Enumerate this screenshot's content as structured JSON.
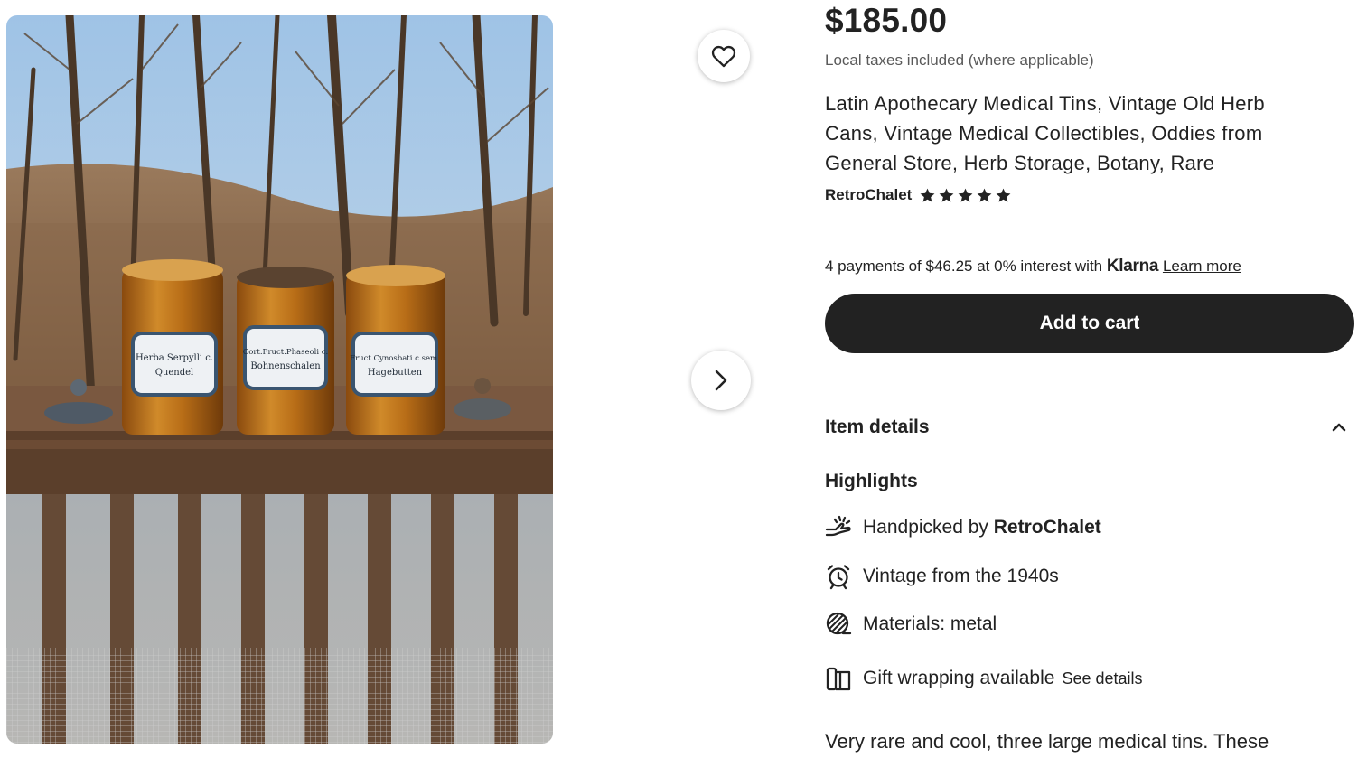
{
  "listing": {
    "price": "$185.00",
    "tax_note": "Local taxes included (where applicable)",
    "title": "Latin Apothecary Medical Tins, Vintage Old Herb Cans, Vintage Medical Collectibles, Oddies from General Store, Herb Storage, Botany, Rare",
    "shop_name": "RetroChalet",
    "rating_stars": 5
  },
  "photo": {
    "tin_labels": [
      [
        "Herba Serpylli c.",
        "Quendel"
      ],
      [
        "Cort.Fruct.Phaseoli c.",
        "Bohnenschalen"
      ],
      [
        "Fruct.Cynosbati c.sem.",
        "Hagebutten"
      ]
    ]
  },
  "klarna": {
    "text": "4 payments of $46.25 at 0% interest with",
    "brand": "Klarna",
    "learn_more": "Learn more"
  },
  "cart": {
    "add_label": "Add to cart"
  },
  "details": {
    "heading": "Item details",
    "highlights_heading": "Highlights",
    "handpicked_prefix": "Handpicked by",
    "handpicked_shop": "RetroChalet",
    "vintage": "Vintage from the 1940s",
    "materials": "Materials: metal",
    "gift": "Gift wrapping available",
    "see_details": "See details",
    "description_start": "Very rare and cool, three large medical tins. These"
  },
  "icons": {
    "favorite": "heart-icon",
    "next": "chevron-right-icon",
    "collapse": "chevron-up-icon",
    "star": "star-icon",
    "handpicked": "hand-sparkle-icon",
    "vintage": "alarm-clock-icon",
    "materials": "yarn-ball-icon",
    "gift": "gift-wrap-icon"
  },
  "colors": {
    "text": "#222222",
    "muted": "#595959",
    "button_bg": "#222222",
    "button_text": "#ffffff"
  }
}
